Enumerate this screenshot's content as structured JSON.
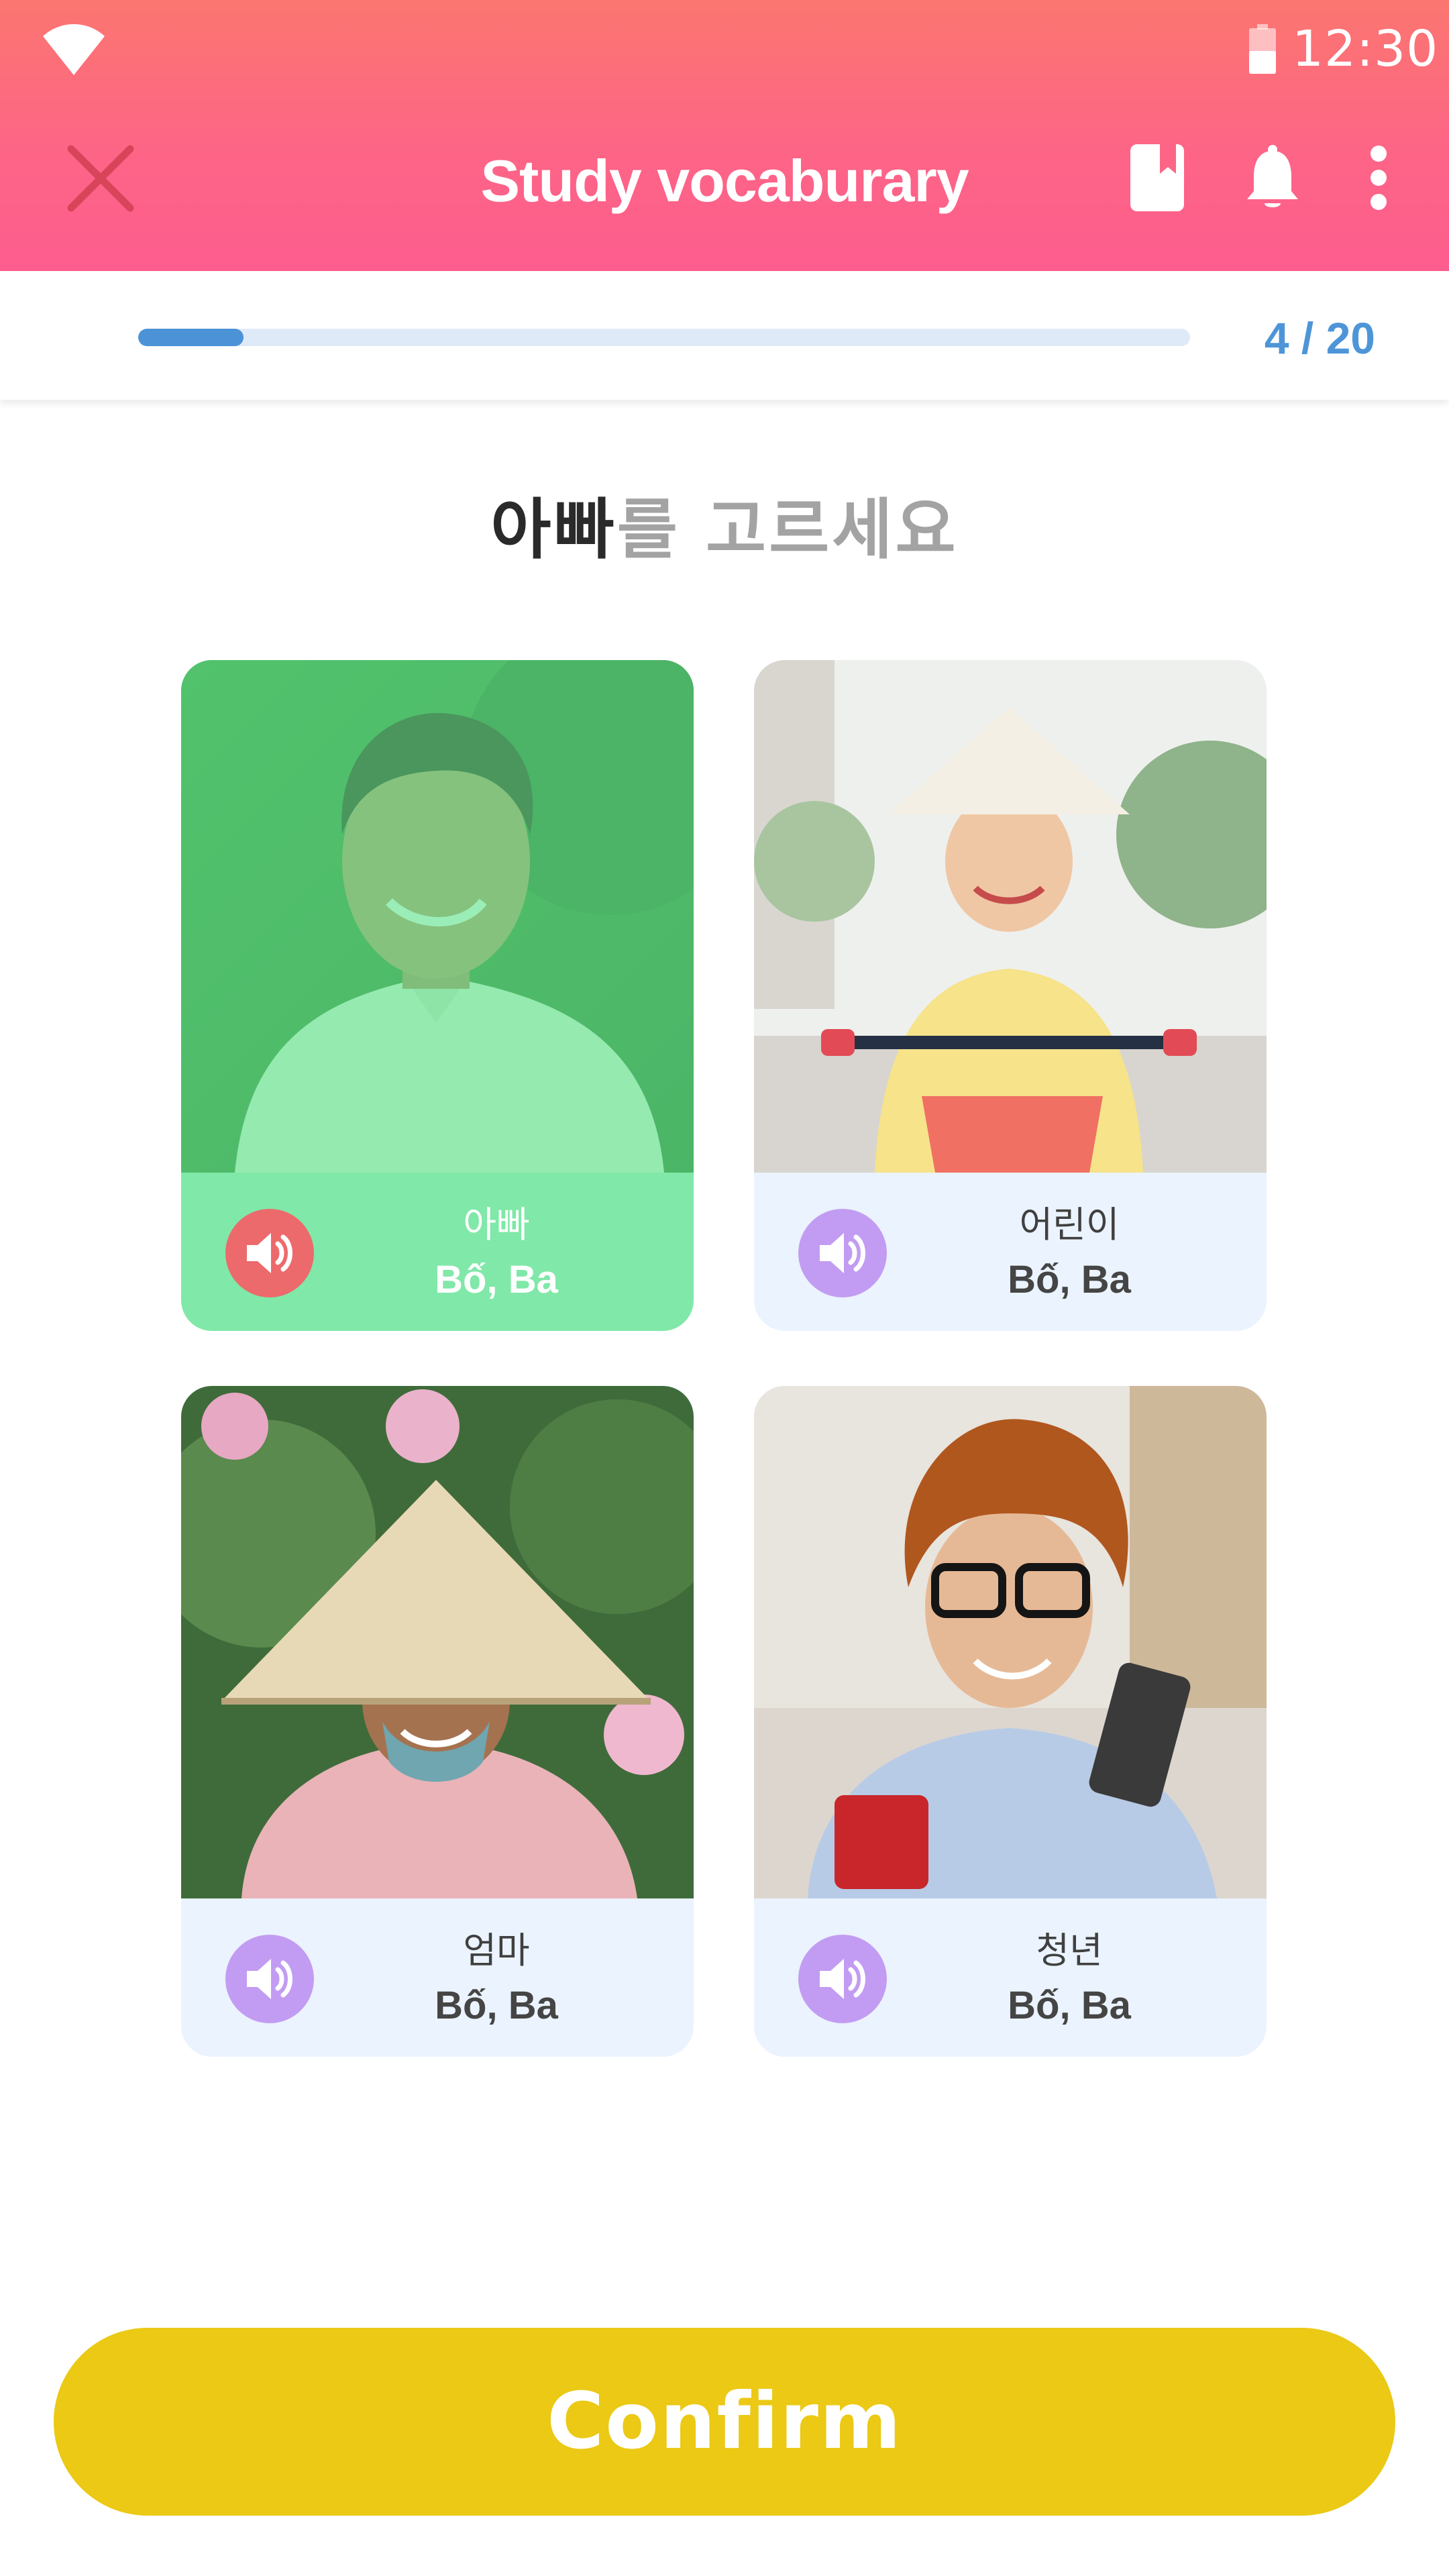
{
  "status_bar": {
    "time": "12:30",
    "wifi_icon": "wifi-icon",
    "battery_icon": "battery-icon"
  },
  "header": {
    "title": "Study vocaburary",
    "close_icon": "close-icon",
    "actions": [
      "bookmark-icon",
      "bell-icon",
      "more-vertical-icon"
    ]
  },
  "progress": {
    "label": "4 / 20",
    "current": 4,
    "total": 20,
    "fill_fraction": 0.1
  },
  "prompt": {
    "word": "아빠",
    "rest": "를 고르세요"
  },
  "cards": [
    {
      "word": "아빠",
      "meaning": "Bố, Ba",
      "selected": true,
      "image": "smiling man in green polo shirt"
    },
    {
      "word": "어린이",
      "meaning": "Bố, Ba",
      "selected": false,
      "image": "child in conical hat riding bicycle"
    },
    {
      "word": "엄마",
      "meaning": "Bố, Ba",
      "selected": false,
      "image": "woman in conical hat among lotus flowers"
    },
    {
      "word": "청년",
      "meaning": "Bố, Ba",
      "selected": false,
      "image": "young man with glasses holding phone and red mug"
    }
  ],
  "confirm_label": "Confirm",
  "colors": {
    "header_top": "#fb7670",
    "header_bottom": "#fd5d8e",
    "progress_fill": "#4b92d6",
    "progress_track": "#dfeaf8",
    "selected_card": "#80e8a8",
    "card_bg": "#ebf3fe",
    "speaker_default": "#c29cf2",
    "speaker_selected": "#ec6a6c",
    "confirm": "#ebc914"
  }
}
